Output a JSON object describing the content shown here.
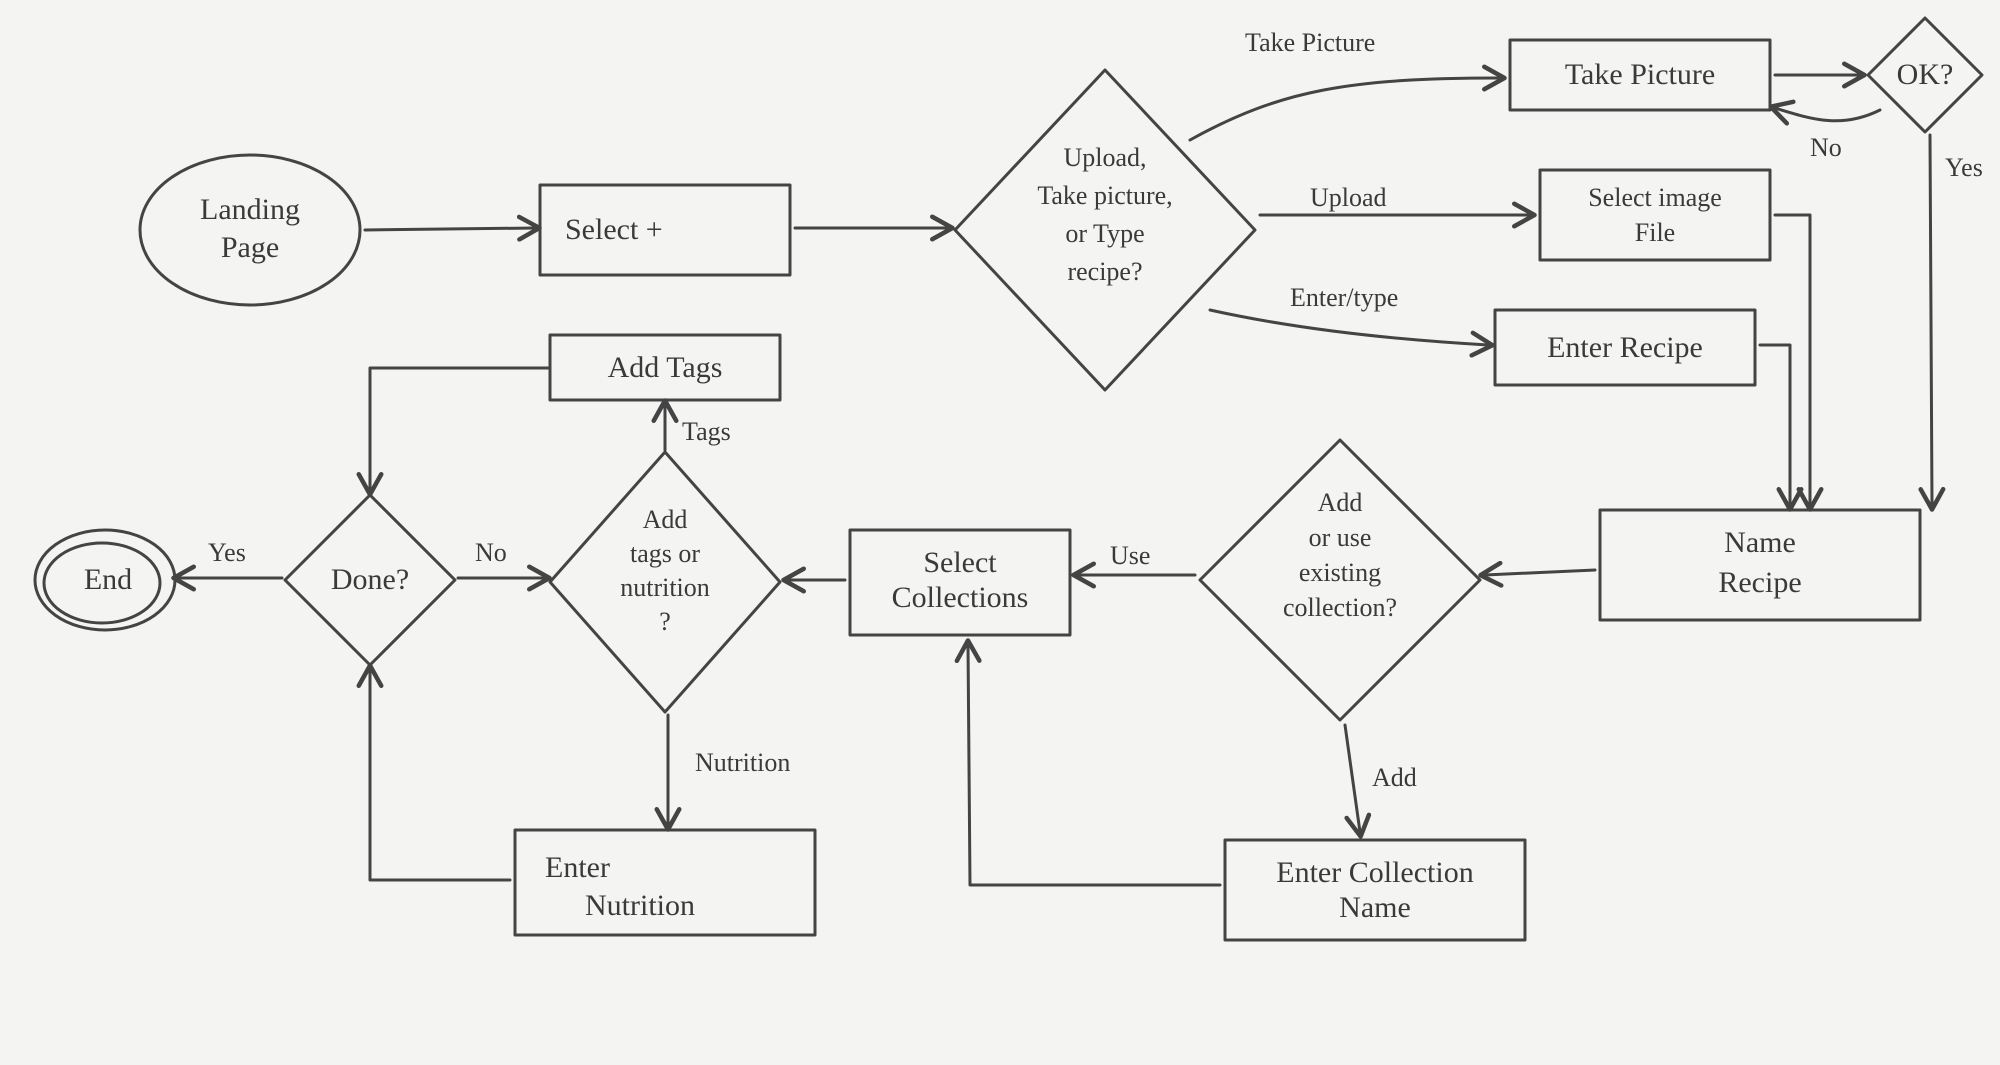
{
  "nodes": {
    "landing_page_l1": "Landing",
    "landing_page_l2": "Page",
    "select_plus": "Select +",
    "decision_input_l1": "Upload,",
    "decision_input_l2": "Take picture,",
    "decision_input_l3": "or Type",
    "decision_input_l4": "recipe?",
    "take_picture": "Take Picture",
    "ok": "OK?",
    "select_image_l1": "Select image",
    "select_image_l2": "File",
    "enter_recipe": "Enter Recipe",
    "name_recipe_l1": "Name",
    "name_recipe_l2": "Recipe",
    "collection_decision_l1": "Add",
    "collection_decision_l2": "or use",
    "collection_decision_l3": "existing",
    "collection_decision_l4": "collection?",
    "enter_collection_l1": "Enter Collection",
    "enter_collection_l2": "Name",
    "select_collections_l1": "Select",
    "select_collections_l2": "Collections",
    "tags_decision_l1": "Add",
    "tags_decision_l2": "tags or",
    "tags_decision_l3": "nutrition",
    "tags_decision_l4": "?",
    "add_tags": "Add Tags",
    "enter_nutrition_l1": "Enter",
    "enter_nutrition_l2": "Nutrition",
    "done": "Done?",
    "end": "End"
  },
  "edges": {
    "take_picture": "Take Picture",
    "upload": "Upload",
    "enter_type": "Enter/type",
    "no": "No",
    "yes": "Yes",
    "use": "Use",
    "add": "Add",
    "tags": "Tags",
    "nutrition": "Nutrition",
    "done_no": "No",
    "done_yes": "Yes"
  }
}
